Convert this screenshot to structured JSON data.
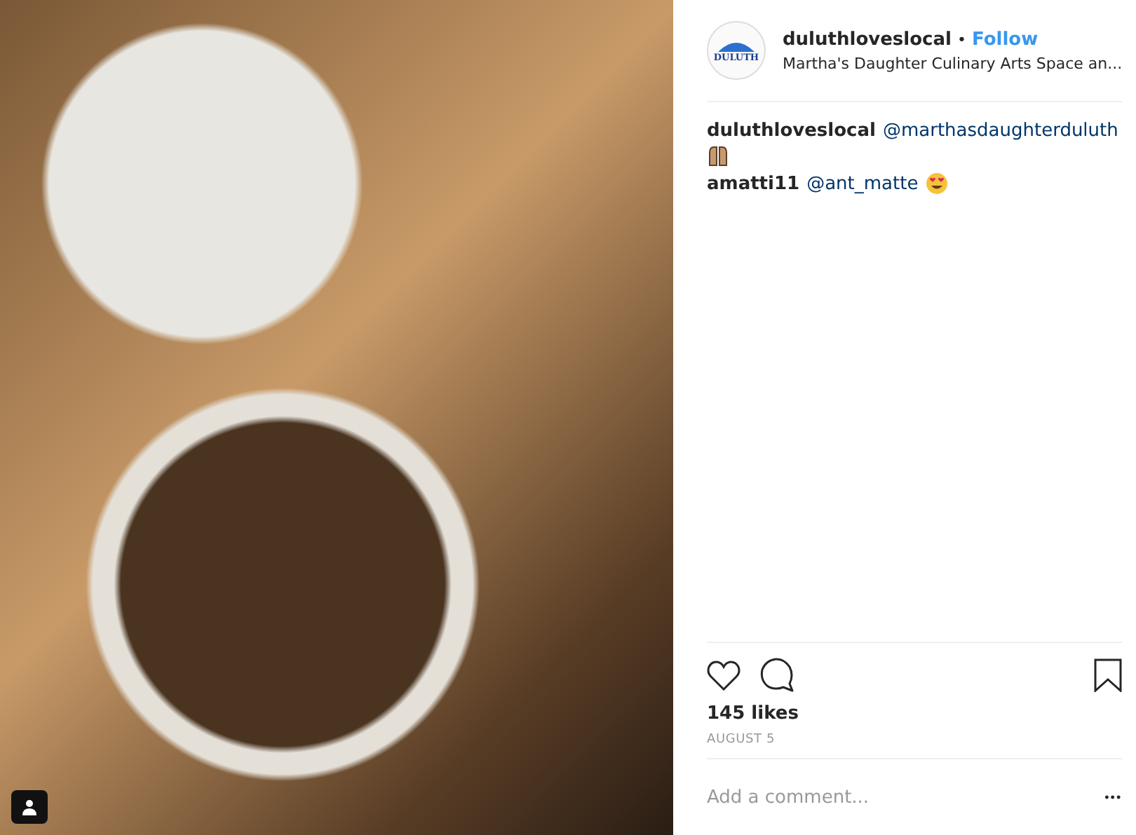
{
  "photo": {
    "tag_badge": true
  },
  "header": {
    "avatar_text": "DULUTH",
    "username": "duluthloveslocal",
    "separator": "•",
    "follow": "Follow",
    "location": "Martha's Daughter Culinary Arts Space an..."
  },
  "comments": [
    {
      "username": "duluthloveslocal",
      "mention": "@marthasdaughterduluth",
      "kind": "raised-hands"
    },
    {
      "username": "amatti11",
      "mention": "@ant_matte",
      "kind": "heart-eyes"
    }
  ],
  "likes": "145 likes",
  "date": "AUGUST 5",
  "comment_field": {
    "placeholder": "Add a comment..."
  },
  "more": "•••"
}
